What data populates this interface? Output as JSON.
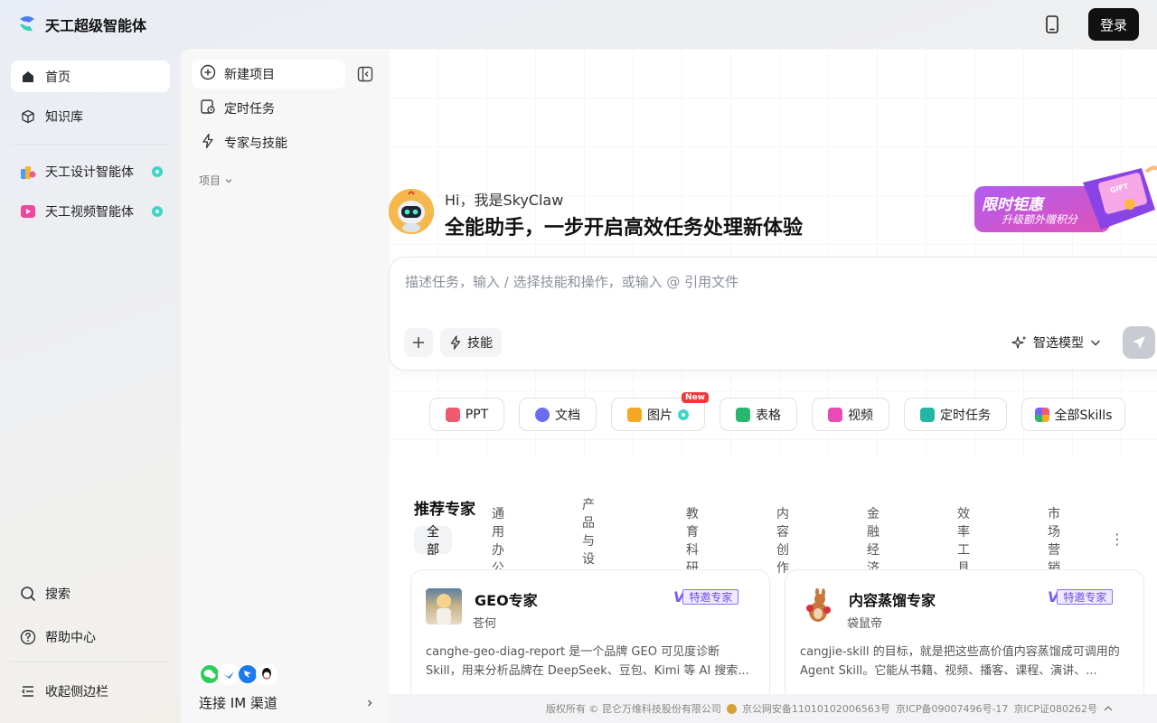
{
  "app": {
    "title": "天工超级智能体",
    "login_label": "登录"
  },
  "sidebar": {
    "items": [
      {
        "label": "首页",
        "icon": "home-icon"
      },
      {
        "label": "知识库",
        "icon": "cube-icon"
      },
      {
        "label": "天工设计智能体",
        "icon": "design-agent-icon"
      },
      {
        "label": "天工视频智能体",
        "icon": "video-agent-icon"
      }
    ],
    "bottom": [
      {
        "label": "搜索",
        "icon": "search-icon"
      },
      {
        "label": "帮助中心",
        "icon": "help-icon"
      },
      {
        "label": "收起侧边栏",
        "icon": "collapse-icon"
      }
    ]
  },
  "panel": {
    "items": [
      {
        "label": "新建项目",
        "icon": "plus-circle-icon"
      },
      {
        "label": "定时任务",
        "icon": "scheduled-task-icon"
      },
      {
        "label": "专家与技能",
        "icon": "lightning-icon"
      }
    ],
    "project_label": "项目",
    "im_label": "连接 IM 渠道"
  },
  "hero": {
    "greeting": "Hi，我是SkyClaw",
    "headline": "全能助手，一步开启高效任务处理新体验",
    "promo_line1": "限时钜惠",
    "promo_line2": "升级额外赠积分",
    "promo_gift": "GIFT"
  },
  "composer": {
    "placeholder": "描述任务，输入 / 选择技能和操作，或输入 @ 引用文件",
    "skill_label": "技能",
    "model_label": "智选模型"
  },
  "chips": [
    {
      "label": "PPT",
      "color": "#ef5a6f"
    },
    {
      "label": "文档",
      "color": "#6b6cf0"
    },
    {
      "label": "图片",
      "color": "#f5a623",
      "badge": "New"
    },
    {
      "label": "表格",
      "color": "#29b86b"
    },
    {
      "label": "视频",
      "color": "#e84bb5"
    },
    {
      "label": "定时任务",
      "color": "#22b7a4"
    },
    {
      "label": "全部Skills",
      "color": "#7b61ff"
    }
  ],
  "experts": {
    "title": "推荐专家",
    "tabs": [
      "全部",
      "通用办公",
      "产品与设计",
      "教育科研",
      "内容创作",
      "金融经济",
      "效率工具",
      "市场营销"
    ],
    "cards": [
      {
        "title": "GEO专家",
        "author": "苍何",
        "badge": "特邀专家",
        "desc": "canghe-geo-diag-report 是一个品牌 GEO 可见度诊断 Skill，用来分析品牌在 DeepSeek、豆包、Kimi 等 AI 搜索..."
      },
      {
        "title": "内容蒸馏专家",
        "author": "袋鼠帝",
        "badge": "特邀专家",
        "desc": "cangjie-skill 的目标，就是把这些高价值内容蒸馏成可调用的 Agent Skill。它能从书籍、视频、播客、课程、演讲、..."
      }
    ]
  },
  "footer": {
    "copyright": "版权所有 © 昆仑万维科技股份有限公司",
    "police": "京公网安备11010102006563号",
    "icp1": "京ICP备09007496号-17",
    "icp2": "京ICP证080262号"
  }
}
